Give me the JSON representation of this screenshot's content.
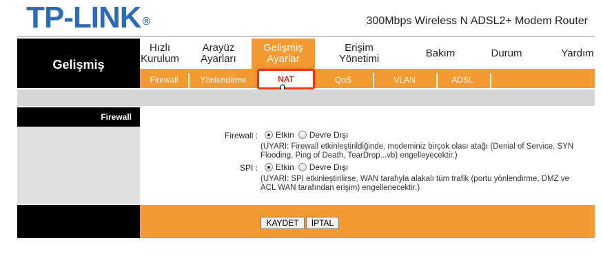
{
  "header": {
    "logo": "TP-LINK",
    "logo_mark": "®",
    "product": "300Mbps Wireless N ADSL2+ Modem Router"
  },
  "left": {
    "title": "Gelişmiş",
    "section": "Firewall"
  },
  "nav": {
    "items": [
      {
        "label": "Hızlı Kurulum"
      },
      {
        "label": "Arayüz Ayarları"
      },
      {
        "label": "Gelişmiş Ayarlar"
      },
      {
        "label": "Erişim Yönetimi"
      },
      {
        "label": "Bakım"
      },
      {
        "label": "Durum"
      },
      {
        "label": "Yardım"
      }
    ],
    "active": "Gelişmiş Ayarlar"
  },
  "subnav": {
    "items": [
      {
        "label": "Firewall"
      },
      {
        "label": "Yönlendirme"
      },
      {
        "label": "NAT"
      },
      {
        "label": "QoS"
      },
      {
        "label": "VLAN"
      },
      {
        "label": "ADSL"
      }
    ],
    "highlighted": "NAT"
  },
  "form": {
    "firewall": {
      "label": "Firewall :",
      "on": "Etkin",
      "off": "Devre Dışı",
      "selected": "Etkin",
      "note_line1": "(UYARI: Firewall etkinleştirildiğinde, modeminiz birçok olası atağı (Denial of Service, SYN",
      "note_line2": "Flooding, Ping of Death, TearDrop...vb) engelleyecektir.)"
    },
    "spi": {
      "label": "SPI :",
      "on": "Etkin",
      "off": "Devre Dışı",
      "selected": "Etkin",
      "note_line1": "(UYARI: SPI etkinleştirilirse, WAN tarafıyla alakalı tüm trafik (portu yönlendirme, DMZ ve",
      "note_line2": "ACL WAN tarafından erişim) engellenecektir.)"
    }
  },
  "buttons": {
    "save": "KAYDET",
    "cancel": "İPTAL"
  },
  "colors": {
    "accent": "#f39a31",
    "brand": "#2e6bb5",
    "highlight": "#e8371a"
  }
}
